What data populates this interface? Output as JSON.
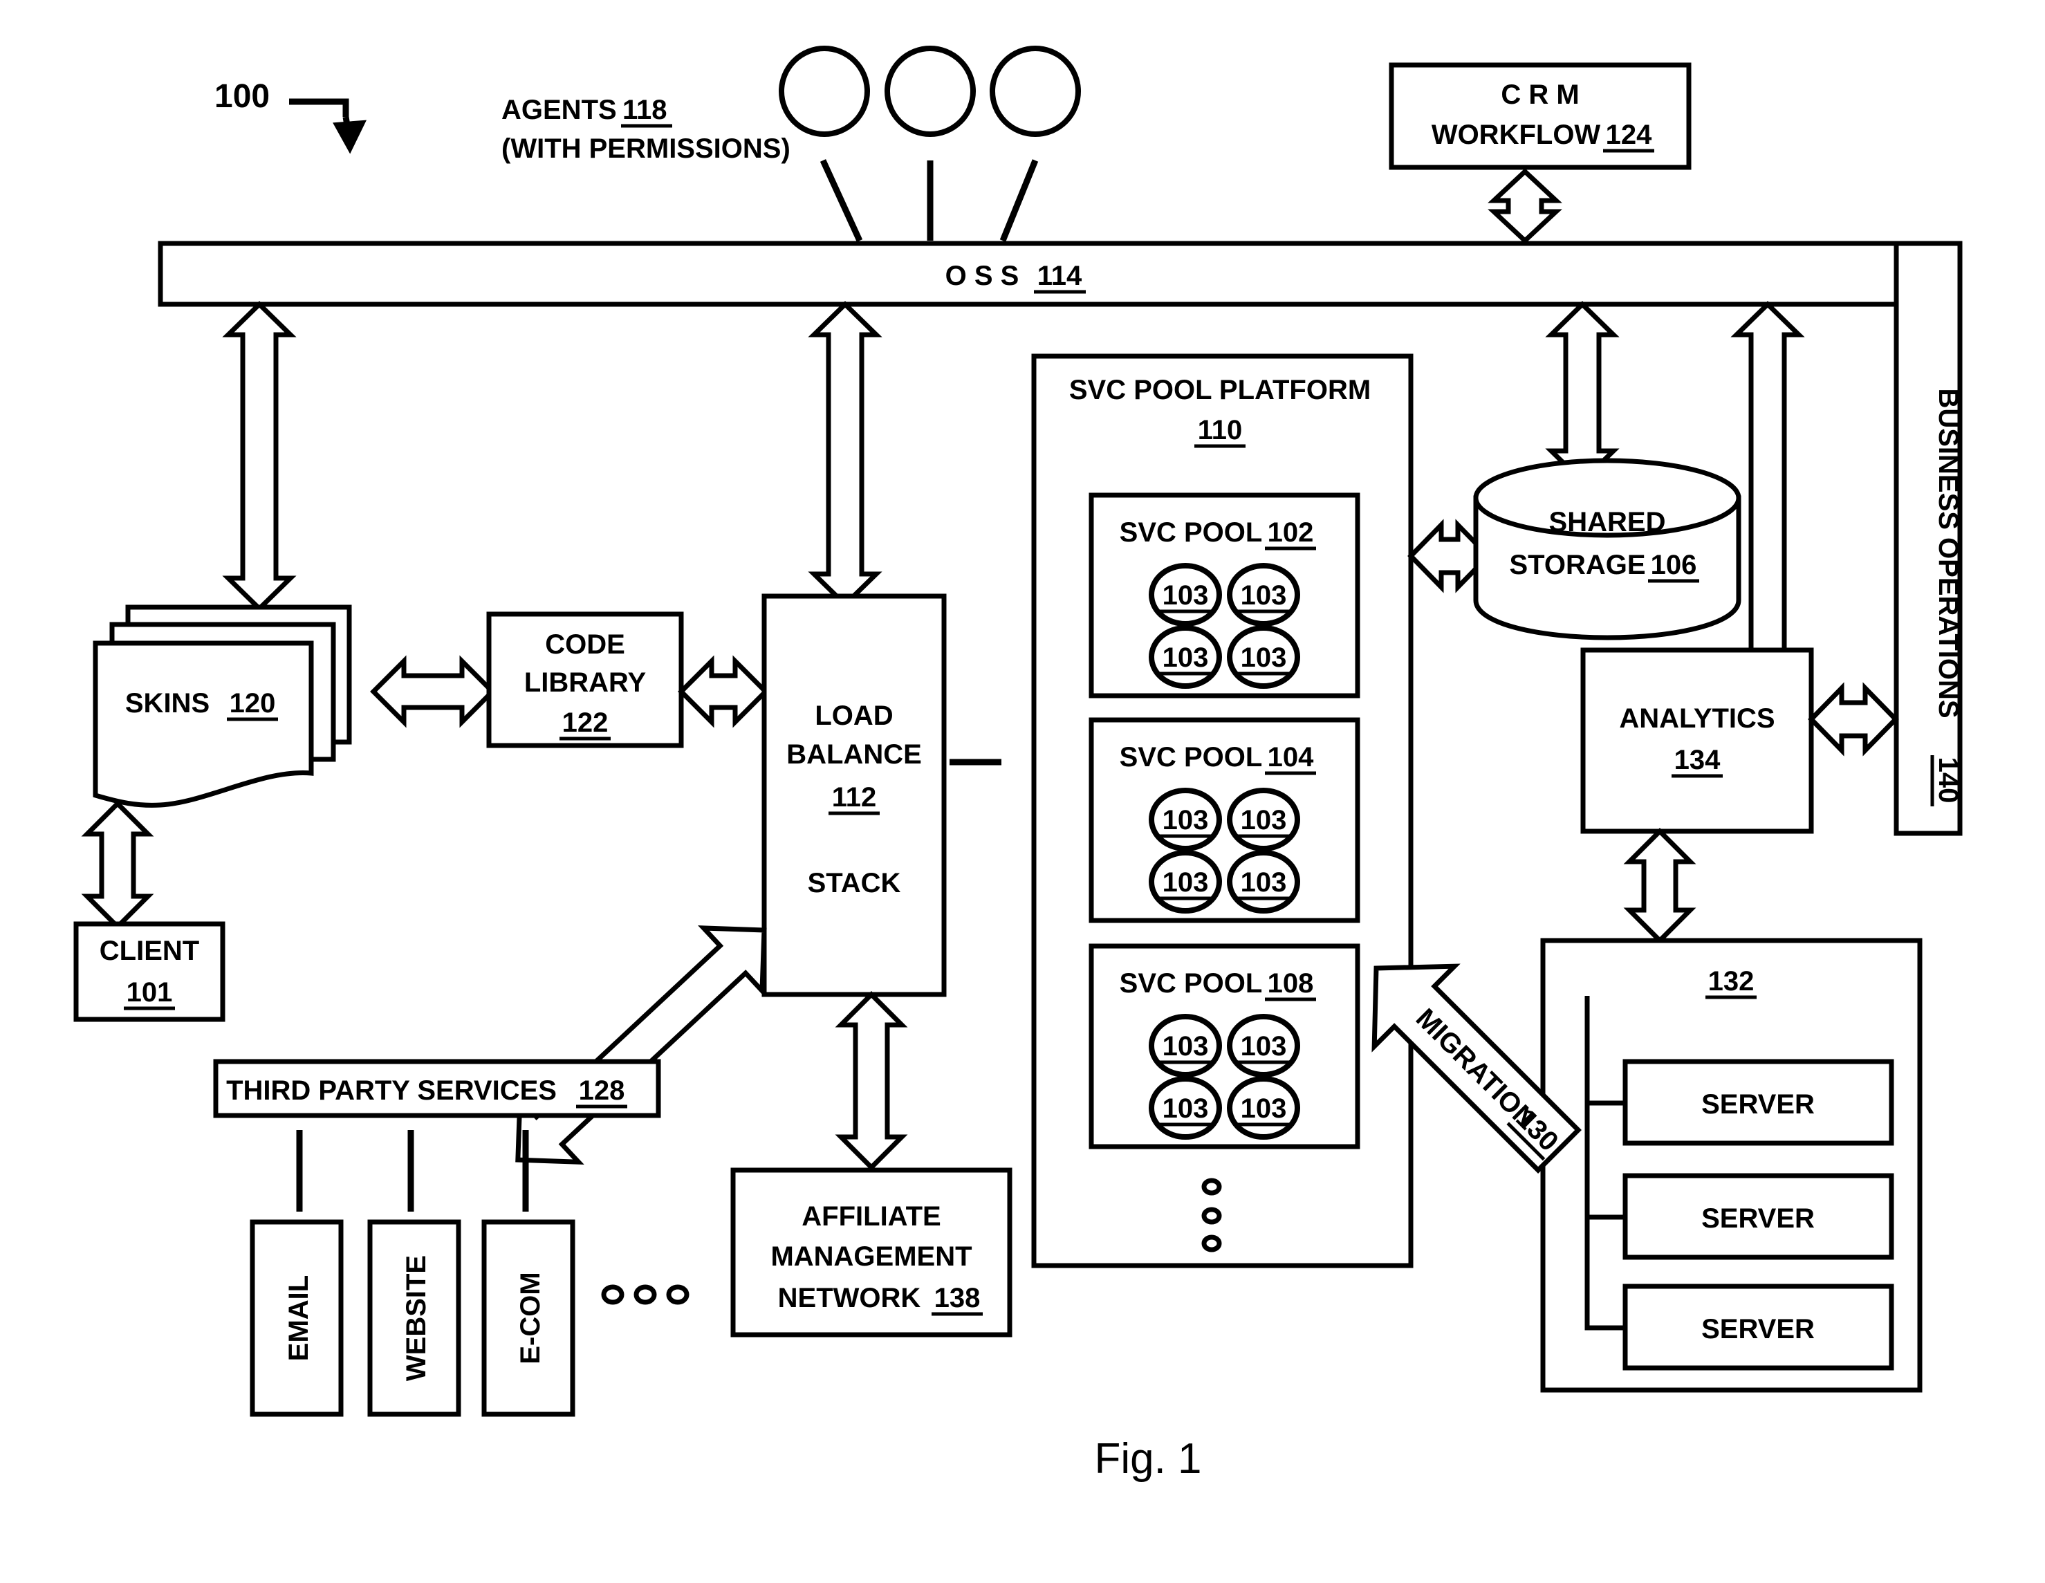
{
  "figure": {
    "caption": "Fig. 1",
    "system_number": "100"
  },
  "nodes": {
    "agents": {
      "line1": "AGENTS 118",
      "line2": "(WITH PERMISSIONS)",
      "label": "AGENTS",
      "ref": "118",
      "note": "(WITH PERMISSIONS)",
      "icon_count": 3
    },
    "crm": {
      "line1": "C R M",
      "line2": "WORKFLOW",
      "ref": "124"
    },
    "oss": {
      "label": "O S S",
      "ref": "114"
    },
    "business_operations": {
      "label": "BUSINESS OPERATIONS",
      "ref": "140"
    },
    "svc_pool_platform": {
      "label": "SVC POOL PLATFORM",
      "ref": "110",
      "pools": [
        {
          "label": "SVC POOL",
          "ref": "102",
          "nodes": [
            "103",
            "103",
            "103",
            "103"
          ]
        },
        {
          "label": "SVC POOL",
          "ref": "104",
          "nodes": [
            "103",
            "103",
            "103",
            "103"
          ]
        },
        {
          "label": "SVC POOL",
          "ref": "108",
          "nodes": [
            "103",
            "103",
            "103",
            "103"
          ]
        }
      ],
      "more_indicator": "vertical-ellipsis"
    },
    "shared_storage": {
      "line1": "SHARED",
      "line2": "STORAGE",
      "ref": "106"
    },
    "analytics": {
      "label": "ANALYTICS",
      "ref": "134"
    },
    "server_cluster": {
      "ref": "132",
      "servers": [
        "SERVER",
        "SERVER",
        "SERVER"
      ]
    },
    "migration": {
      "label": "MIGRATION",
      "ref": "130"
    },
    "skins": {
      "label": "SKINS",
      "ref": "120"
    },
    "client": {
      "label": "CLIENT",
      "ref": "101"
    },
    "code_library": {
      "line1": "CODE",
      "line2": "LIBRARY",
      "ref": "122"
    },
    "load_balance": {
      "line1": "LOAD",
      "line2": "BALANCE",
      "ref": "112",
      "line3": "STACK"
    },
    "third_party_services": {
      "label": "THIRD PARTY SERVICES",
      "ref": "128",
      "children": [
        "EMAIL",
        "WEBSITE",
        "E-COM"
      ],
      "more_indicator": "horizontal-ellipsis"
    },
    "affiliate_network": {
      "line1": "AFFILIATE",
      "line2": "MANAGEMENT",
      "line3": "NETWORK",
      "ref": "138"
    }
  },
  "colors": {
    "stroke": "#000000",
    "fill": "#ffffff"
  }
}
